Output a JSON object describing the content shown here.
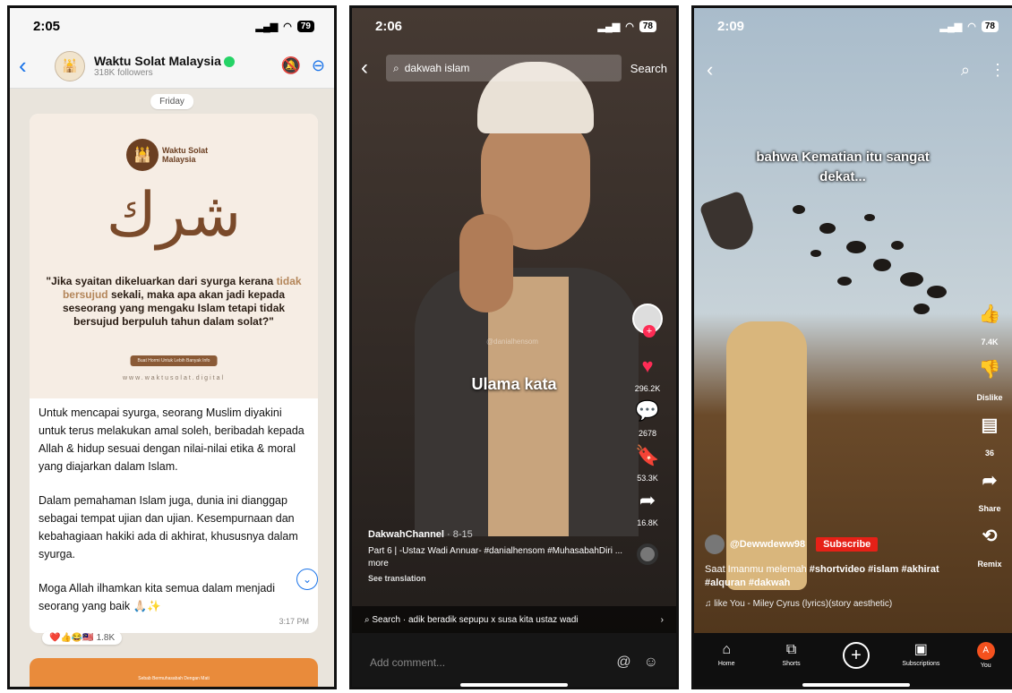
{
  "phone1": {
    "status_time": "2:05",
    "battery": "79",
    "channel_title": "Waktu Solat Malaysia",
    "followers": "318K followers",
    "day_label": "Friday",
    "poster": {
      "logo_line1": "Waktu Solat",
      "logo_line2": "Malaysia",
      "arabic_word": "شرك",
      "quote_before": "\"Jika syaitan dikeluarkan dari syurga kerana ",
      "quote_highlight": "tidak bersujud",
      "quote_after": " sekali, maka apa akan jadi kepada seseorang yang mengaku Islam tetapi tidak bersujud berpuluh tahun dalam solat?\"",
      "button": "Buat Hormi Untuk Lebih Banyak Info",
      "url": "www.waktusolat.digital"
    },
    "paragraph1": "Untuk mencapai syurga, seorang Muslim diyakini untuk terus melakukan amal soleh, beribadah kepada Allah & hidup sesuai dengan nilai-nilai etika & moral yang diajarkan dalam Islam.",
    "paragraph2": "Dalam pemahaman Islam juga, dunia ini dianggap sebagai tempat ujian dan ujian. Kesempurnaan dan kebahagiaan hakiki ada di akhirat, khususnya dalam syurga.",
    "paragraph3": "Moga Allah ilhamkan kita semua dalam menjadi seorang yang baik 🙏🏻✨",
    "time": "3:17 PM",
    "reactions": "❤️👍😂🇲🇾 1.8K",
    "next_poster_text": "Sebab Bermuhasabah Dengan Mati"
  },
  "phone2": {
    "status_time": "2:06",
    "battery": "78",
    "search_query": "dakwah islam",
    "search_button": "Search",
    "caption": "Ulama kata",
    "watermark": "@danialhensom",
    "likes": "296.2K",
    "comments": "2678",
    "saves": "53.3K",
    "shares": "16.8K",
    "channel": "DakwahChannel",
    "date": "· 8-15",
    "description": "Part 6 | -Ustaz Wadi Annuar- #danialhensom #MuhasabahDiri ... more",
    "see_translation": "See translation",
    "related_search": "Search · adik beradik sepupu x susa kita ustaz wadi",
    "add_comment": "Add comment..."
  },
  "phone3": {
    "status_time": "2:09",
    "battery": "78",
    "caption": "bahwa Kematian itu sangat dekat...",
    "likes": "7.4K",
    "dislike": "Dislike",
    "comments": "36",
    "share": "Share",
    "remix": "Remix",
    "channel": "@Dewwdeww98",
    "subscribe": "Subscribe",
    "desc_plain": "Saat Imanmu melemah ",
    "desc_tags": "#shortvideo #islam #akhirat #alquran #dakwah",
    "music": "♫  like You - Miley Cyrus (lyrics)(story aesthetic)",
    "nav": {
      "home": "Home",
      "shorts": "Shorts",
      "subscriptions": "Subscriptions",
      "you": "You",
      "you_initial": "A"
    }
  },
  "colors": {
    "whatsapp_blue": "#1a73e8",
    "tiktok_red": "#fe2c55",
    "youtube_red": "#e62117"
  }
}
